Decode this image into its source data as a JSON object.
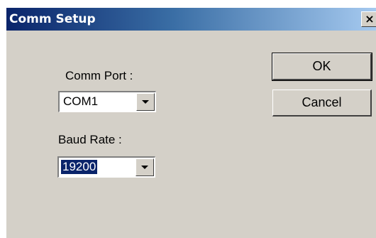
{
  "window": {
    "title": "Comm Setup",
    "close_glyph": "×"
  },
  "comm_port": {
    "label": "Comm Port :",
    "value": "COM1"
  },
  "baud_rate": {
    "label": "Baud Rate :",
    "value": "19200"
  },
  "buttons": {
    "ok": "OK",
    "cancel": "Cancel"
  },
  "icons": {
    "close": "close-icon",
    "dropdown": "chevron-down-icon"
  },
  "colors": {
    "title_gradient_start": "#0a246a",
    "title_gradient_end": "#a6caf0",
    "face": "#d4d0c8",
    "selection": "#0a246a"
  }
}
